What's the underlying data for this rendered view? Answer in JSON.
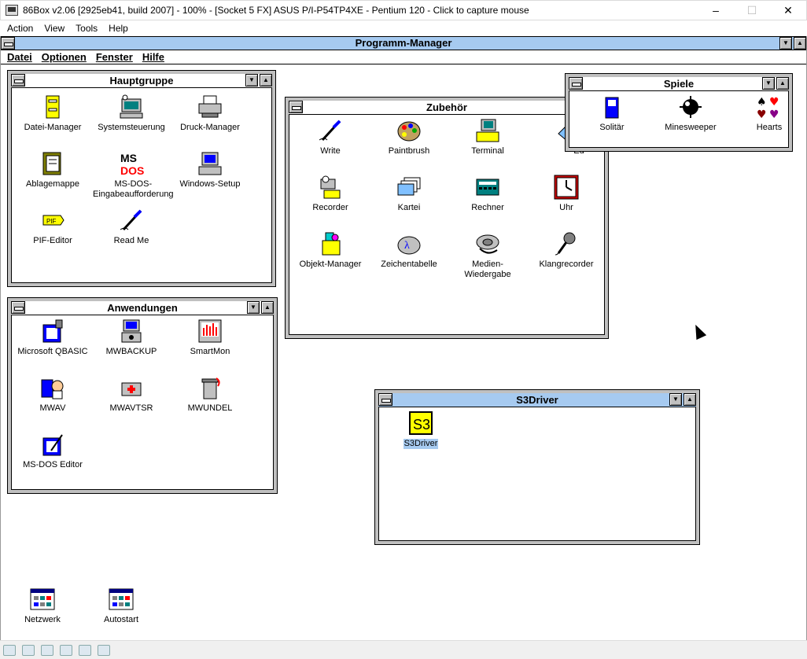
{
  "host": {
    "title": "86Box v2.06 [2925eb41, build 2007] - 100% - [Socket 5 FX] ASUS P/I-P54TP4XE - Pentium 120 - Click to capture mouse",
    "menu": [
      "Action",
      "View",
      "Tools",
      "Help"
    ]
  },
  "program_manager": {
    "title": "Programm-Manager",
    "menu": [
      "Datei",
      "Optionen",
      "Fenster",
      "Hilfe"
    ]
  },
  "groups": {
    "hauptgruppe": {
      "title": "Hauptgruppe",
      "icons": [
        "Datei-Manager",
        "Systemsteuerung",
        "Druck-Manager",
        "Ablagemappe",
        "MS-DOS-Eingabeaufforderung",
        "Windows-Setup",
        "PIF-Editor",
        "Read Me"
      ]
    },
    "zubehoer": {
      "title": "Zubehör",
      "icons": [
        "Write",
        "Paintbrush",
        "Terminal",
        "Ed",
        "Recorder",
        "Kartei",
        "Rechner",
        "Uhr",
        "Objekt-Manager",
        "Zeichentabelle",
        "Medien-Wiedergabe",
        "Klangrecorder"
      ]
    },
    "spiele": {
      "title": "Spiele",
      "icons": [
        "Solitär",
        "Minesweeper",
        "Hearts"
      ]
    },
    "anwendungen": {
      "title": "Anwendungen",
      "icons": [
        "Microsoft QBASIC",
        "MWBACKUP",
        "SmartMon",
        "MWAV",
        "MWAVTSR",
        "MWUNDEL",
        "MS-DOS Editor"
      ]
    },
    "s3driver": {
      "title": "S3Driver",
      "icons": [
        "S3Driver"
      ]
    }
  },
  "minimized_groups": [
    "Netzwerk",
    "Autostart"
  ],
  "icon_glyphs": {
    "solitaire": "♠♥"
  }
}
